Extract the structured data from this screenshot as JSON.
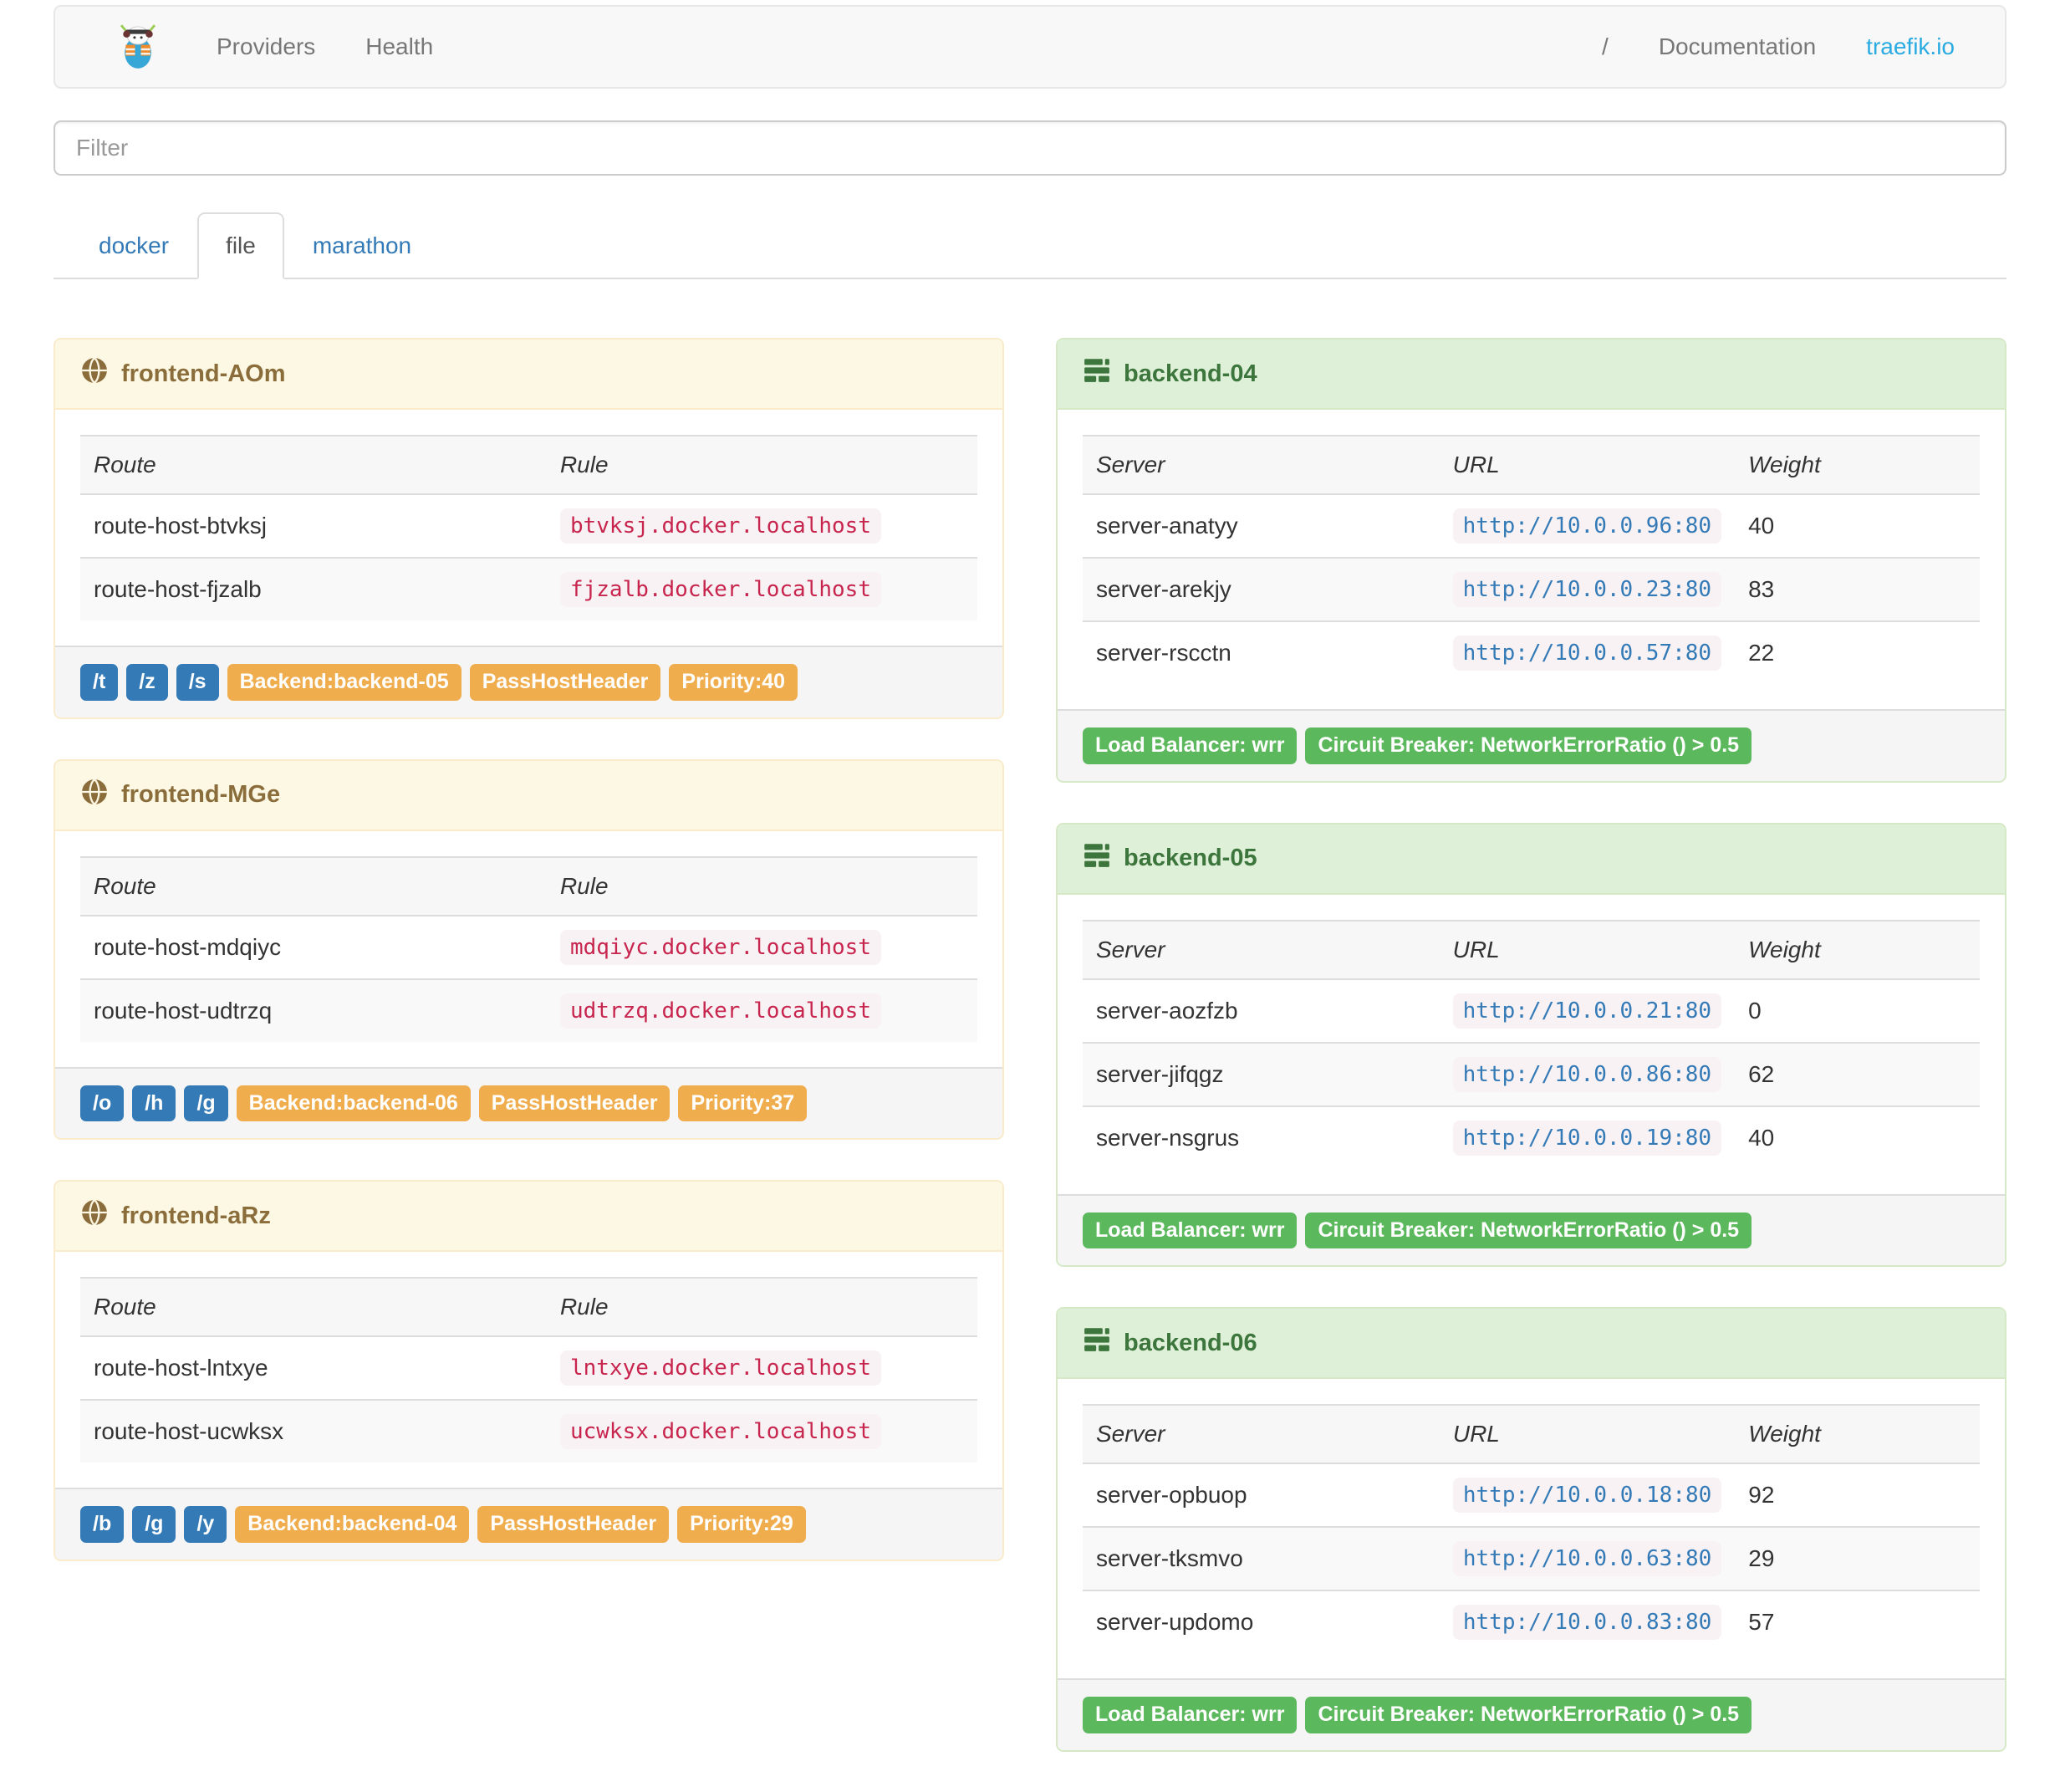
{
  "navbar": {
    "brand_icon": "traefik-logo",
    "left_links": [
      "Providers",
      "Health"
    ],
    "right_links": [
      "/",
      "Documentation",
      "traefik.io"
    ]
  },
  "filter": {
    "placeholder": "Filter"
  },
  "tabs": [
    {
      "label": "docker",
      "active": false
    },
    {
      "label": "file",
      "active": true
    },
    {
      "label": "marathon",
      "active": false
    }
  ],
  "frontend_columns": [
    "Route",
    "Rule"
  ],
  "backend_columns": [
    "Server",
    "URL",
    "Weight"
  ],
  "frontends": [
    {
      "name": "frontend-AOm",
      "routes": [
        {
          "route": "route-host-btvksj",
          "rule": "btvksj.docker.localhost"
        },
        {
          "route": "route-host-fjzalb",
          "rule": "fjzalb.docker.localhost"
        }
      ],
      "entry_badges": [
        "/t",
        "/z",
        "/s"
      ],
      "config_badges": [
        "Backend:backend-05",
        "PassHostHeader",
        "Priority:40"
      ]
    },
    {
      "name": "frontend-MGe",
      "routes": [
        {
          "route": "route-host-mdqiyc",
          "rule": "mdqiyc.docker.localhost"
        },
        {
          "route": "route-host-udtrzq",
          "rule": "udtrzq.docker.localhost"
        }
      ],
      "entry_badges": [
        "/o",
        "/h",
        "/g"
      ],
      "config_badges": [
        "Backend:backend-06",
        "PassHostHeader",
        "Priority:37"
      ]
    },
    {
      "name": "frontend-aRz",
      "routes": [
        {
          "route": "route-host-lntxye",
          "rule": "lntxye.docker.localhost"
        },
        {
          "route": "route-host-ucwksx",
          "rule": "ucwksx.docker.localhost"
        }
      ],
      "entry_badges": [
        "/b",
        "/g",
        "/y"
      ],
      "config_badges": [
        "Backend:backend-04",
        "PassHostHeader",
        "Priority:29"
      ]
    }
  ],
  "backends": [
    {
      "name": "backend-04",
      "servers": [
        {
          "server": "server-anatyy",
          "url": "http://10.0.0.96:80",
          "weight": "40"
        },
        {
          "server": "server-arekjy",
          "url": "http://10.0.0.23:80",
          "weight": "83"
        },
        {
          "server": "server-rscctn",
          "url": "http://10.0.0.57:80",
          "weight": "22"
        }
      ],
      "badges": [
        "Load Balancer: wrr",
        "Circuit Breaker: NetworkErrorRatio () > 0.5"
      ]
    },
    {
      "name": "backend-05",
      "servers": [
        {
          "server": "server-aozfzb",
          "url": "http://10.0.0.21:80",
          "weight": "0"
        },
        {
          "server": "server-jifqgz",
          "url": "http://10.0.0.86:80",
          "weight": "62"
        },
        {
          "server": "server-nsgrus",
          "url": "http://10.0.0.19:80",
          "weight": "40"
        }
      ],
      "badges": [
        "Load Balancer: wrr",
        "Circuit Breaker: NetworkErrorRatio () > 0.5"
      ]
    },
    {
      "name": "backend-06",
      "servers": [
        {
          "server": "server-opbuop",
          "url": "http://10.0.0.18:80",
          "weight": "92"
        },
        {
          "server": "server-tksmvo",
          "url": "http://10.0.0.63:80",
          "weight": "29"
        },
        {
          "server": "server-updomo",
          "url": "http://10.0.0.83:80",
          "weight": "57"
        }
      ],
      "badges": [
        "Load Balancer: wrr",
        "Circuit Breaker: NetworkErrorRatio () > 0.5"
      ]
    }
  ],
  "colors": {
    "frontend_heading_bg": "#fcf8e3",
    "frontend_heading_text": "#8a6d3b",
    "frontend_border": "#faebcc",
    "backend_heading_bg": "#dff0d8",
    "backend_heading_text": "#3c763d",
    "backend_border": "#d6e9c6",
    "badge_primary": "#337ab7",
    "badge_warning": "#f0ad4e",
    "badge_success": "#5cb85c",
    "rule_code_text": "#c7254e",
    "code_bg": "#f9f2f4",
    "url_link": "#337ab7",
    "navbar_bg": "#f8f8f8",
    "brand_link": "#29abe2"
  }
}
